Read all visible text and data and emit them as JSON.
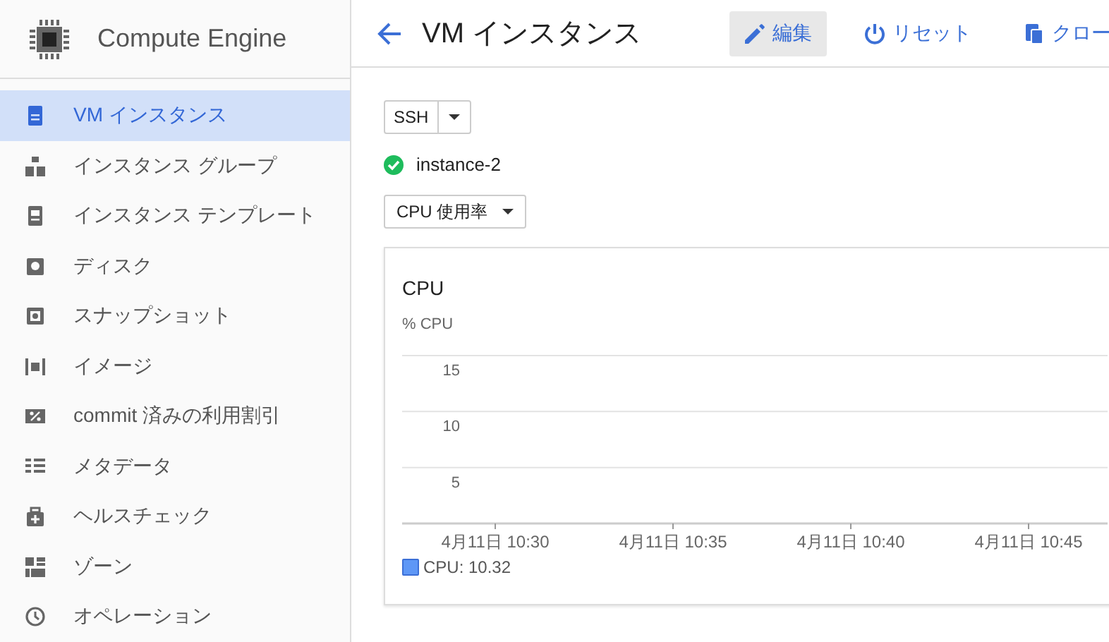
{
  "sidebar": {
    "title": "Compute Engine",
    "items": [
      {
        "label": "VM インスタンス",
        "selected": true
      },
      {
        "label": "インスタンス グループ",
        "selected": false
      },
      {
        "label": "インスタンス テンプレート",
        "selected": false
      },
      {
        "label": "ディスク",
        "selected": false
      },
      {
        "label": "スナップショット",
        "selected": false
      },
      {
        "label": "イメージ",
        "selected": false
      },
      {
        "label": "commit 済みの利用割引",
        "selected": false
      },
      {
        "label": "メタデータ",
        "selected": false
      },
      {
        "label": "ヘルスチェック",
        "selected": false
      },
      {
        "label": "ゾーン",
        "selected": false
      },
      {
        "label": "オペレーション",
        "selected": false
      }
    ]
  },
  "header": {
    "title": "VM インスタンス",
    "actions": [
      {
        "label": "編集",
        "selected": true
      },
      {
        "label": "リセット",
        "selected": false
      },
      {
        "label": "クロー",
        "selected": false
      }
    ]
  },
  "ssh_button": {
    "label": "SSH"
  },
  "instance": {
    "name": "instance-2",
    "running": true
  },
  "metric_select": {
    "value": "CPU 使用率"
  },
  "chart": {
    "legend": "CPU: 10.32",
    "chart_data": {
      "type": "line",
      "title": "CPU",
      "ylabel": "% CPU",
      "yticks": [
        5,
        10,
        15
      ],
      "ylim": [
        0,
        15
      ],
      "grid": true,
      "categories": [
        "4月11日 10:30",
        "4月11日 10:35",
        "4月11日 10:40",
        "4月11日 10:45"
      ]
    }
  }
}
